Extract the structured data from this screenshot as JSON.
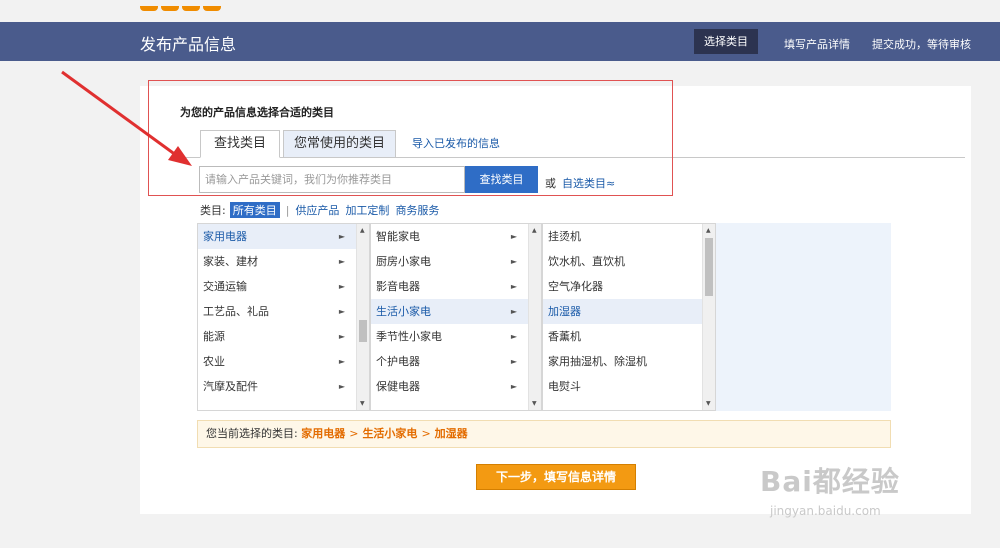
{
  "header": {
    "title": "发布产品信息",
    "steps": [
      "选择类目",
      "填写产品详情",
      "提交成功，等待审核"
    ]
  },
  "prompt": "为您的产品信息选择合适的类目",
  "tabs": {
    "find": "查找类目",
    "common": "您常使用的类目",
    "import": "导入已发布的信息"
  },
  "search": {
    "placeholder": "请输入产品关键词，我们为你推荐类目",
    "button": "查找类目",
    "or": "或",
    "self_select": "自选类目≈"
  },
  "category_filter": {
    "label": "类目:",
    "active": "所有类目",
    "separator": "|",
    "options": [
      "供应产品",
      "加工定制",
      "商务服务"
    ]
  },
  "columns": {
    "col1": [
      "家用电器",
      "家装、建材",
      "交通运输",
      "工艺品、礼品",
      "能源",
      "农业",
      "汽摩及配件"
    ],
    "col2": [
      "智能家电",
      "厨房小家电",
      "影音电器",
      "生活小家电",
      "季节性小家电",
      "个护电器",
      "保健电器"
    ],
    "col3": [
      "挂烫机",
      "饮水机、直饮机",
      "空气净化器",
      "加湿器",
      "香薰机",
      "家用抽湿机、除湿机",
      "电熨斗"
    ]
  },
  "selected": {
    "label": "您当前选择的类目:",
    "path": [
      "家用电器",
      "生活小家电",
      "加湿器"
    ],
    "arrow": ">"
  },
  "next_button": "下一步，填写信息详情",
  "watermark": {
    "brand": "Bai都经验",
    "url": "jingyan.baidu.com"
  }
}
